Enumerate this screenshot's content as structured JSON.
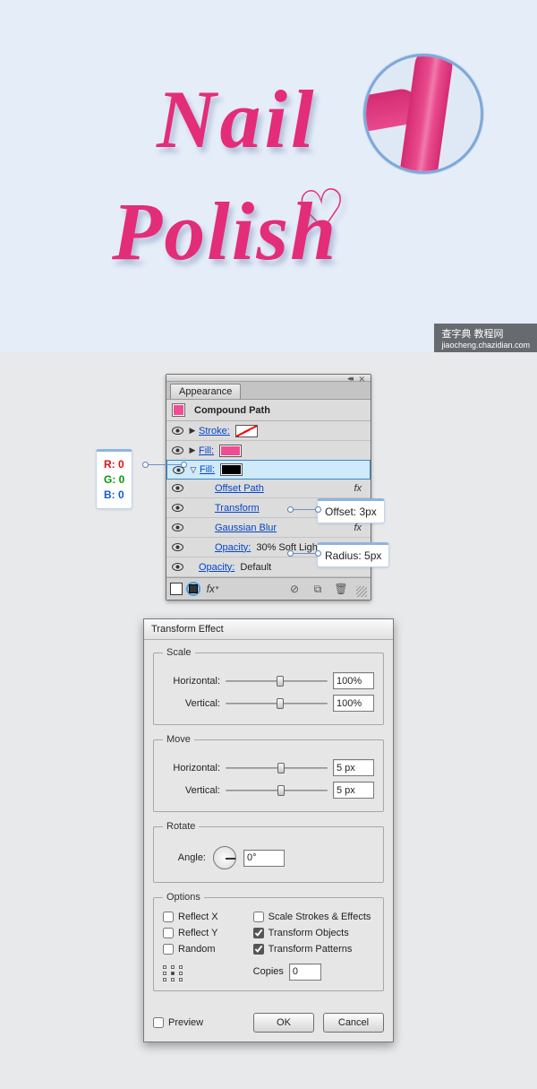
{
  "artwork": {
    "line1": "Nail",
    "line2": "Polish",
    "watermark_main": "查字典  教程网",
    "watermark_sub": "jiaocheng.chazidian.com"
  },
  "callouts": {
    "rgb_r": "R: 0",
    "rgb_g": "G: 0",
    "rgb_b": "B: 0",
    "offset": "Offset: 3px",
    "radius": "Radius: 5px"
  },
  "appearance": {
    "tab": "Appearance",
    "header": "Compound Path",
    "stroke_label": "Stroke:",
    "fill_label": "Fill:",
    "offset_path": "Offset Path",
    "transform": "Transform",
    "gaussian": "Gaussian Blur",
    "opacity_label": "Opacity:",
    "opacity_val1": "30% Soft Light",
    "opacity_val2": "Default",
    "fx": "fx"
  },
  "transform": {
    "title": "Transform Effect",
    "scale_legend": "Scale",
    "move_legend": "Move",
    "rotate_legend": "Rotate",
    "options_legend": "Options",
    "horizontal": "Horizontal:",
    "vertical": "Vertical:",
    "angle": "Angle:",
    "scale_h": "100%",
    "scale_v": "100%",
    "move_h": "5 px",
    "move_v": "5 px",
    "angle_val": "0°",
    "reflect_x": "Reflect X",
    "reflect_y": "Reflect Y",
    "random": "Random",
    "scale_strokes": "Scale Strokes & Effects",
    "transform_objects": "Transform Objects",
    "transform_patterns": "Transform Patterns",
    "copies": "Copies",
    "copies_val": "0",
    "preview": "Preview",
    "ok": "OK",
    "cancel": "Cancel"
  }
}
